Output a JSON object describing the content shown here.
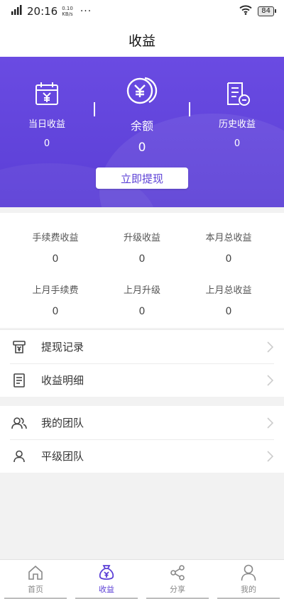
{
  "status": {
    "time": "20:16",
    "net_speed_value": "0.10",
    "net_speed_unit": "KB/s",
    "dots": "···",
    "battery": "84"
  },
  "nav": {
    "title": "收益"
  },
  "hero": {
    "daily": {
      "label": "当日收益",
      "value": "0",
      "icon": "calendar-yen-icon"
    },
    "balance": {
      "label": "余额",
      "value": "0",
      "icon": "yen-coins-icon"
    },
    "history": {
      "label": "历史收益",
      "value": "0",
      "icon": "history-document-icon"
    },
    "withdraw_label": "立即提现",
    "accent": "#5b3fd6"
  },
  "stats": [
    {
      "label": "手续费收益",
      "value": "0"
    },
    {
      "label": "升级收益",
      "value": "0"
    },
    {
      "label": "本月总收益",
      "value": "0"
    },
    {
      "label": "上月手续费",
      "value": "0"
    },
    {
      "label": "上月升级",
      "value": "0"
    },
    {
      "label": "上月总收益",
      "value": "0"
    }
  ],
  "menu1": [
    {
      "label": "提现记录",
      "icon": "receipt-yen-icon"
    },
    {
      "label": "收益明细",
      "icon": "document-list-icon"
    }
  ],
  "menu2": [
    {
      "label": "我的团队",
      "icon": "team-icon"
    },
    {
      "label": "平级团队",
      "icon": "person-icon"
    }
  ],
  "tabs": [
    {
      "label": "首页",
      "icon": "home-icon",
      "active": false
    },
    {
      "label": "收益",
      "icon": "money-bag-icon",
      "active": true
    },
    {
      "label": "分享",
      "icon": "share-icon",
      "active": false
    },
    {
      "label": "我的",
      "icon": "user-icon",
      "active": false
    }
  ]
}
